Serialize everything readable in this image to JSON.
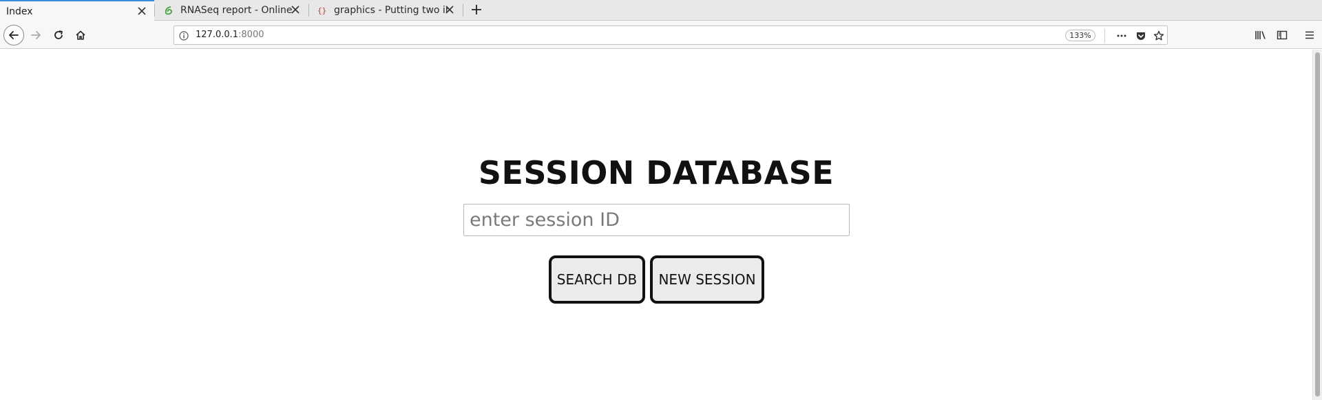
{
  "tabs": [
    {
      "title": "Index",
      "active": true,
      "favicon": "none"
    },
    {
      "title": "RNASeq report - Online L",
      "active": false,
      "favicon": "overleaf-icon"
    },
    {
      "title": "graphics - Putting two ima",
      "active": false,
      "favicon": "braces-icon"
    }
  ],
  "address_bar": {
    "host": "127.0.0.1",
    "port": ":8000",
    "zoom": "133%"
  },
  "toolbar_icons": [
    "back-arrow-icon",
    "forward-arrow-icon",
    "reload-icon",
    "home-icon",
    "site-info-icon",
    "page-actions-icon",
    "pocket-icon",
    "bookmark-star-icon",
    "library-icon",
    "sidebar-icon",
    "hamburger-menu-icon"
  ],
  "page": {
    "title": "SESSION DATABASE",
    "input_placeholder": "enter session ID",
    "input_value": "",
    "search_label": "SEARCH DB",
    "new_session_label": "NEW SESSION"
  },
  "colors": {
    "tab_accent": "#3a8ae0",
    "button_bg": "#ebebeb",
    "button_border": "#111111"
  }
}
